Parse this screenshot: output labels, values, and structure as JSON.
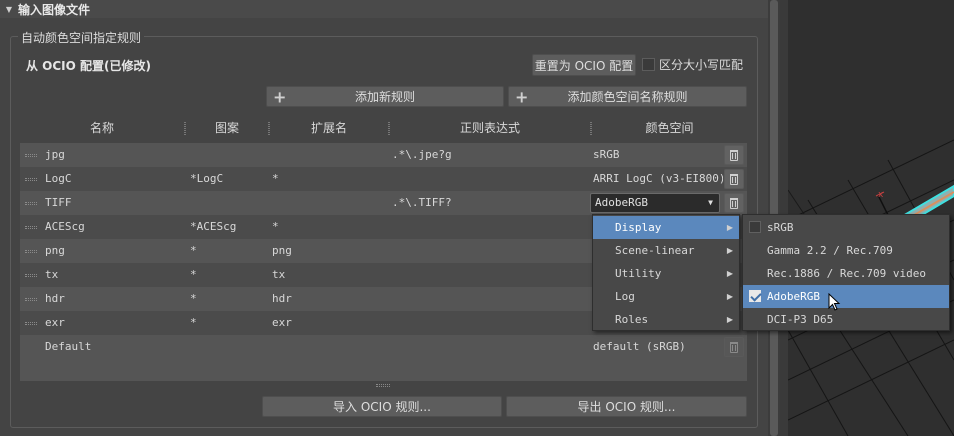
{
  "section": {
    "title": "输入图像文件"
  },
  "group": {
    "title": "自动颜色空间指定规则",
    "ocio_title": "从 OCIO 配置(已修改)",
    "reset_button": "重置为 OCIO 配置",
    "case_label": "区分大小写匹配",
    "add_rule_button": "添加新规则",
    "add_cs_rule_button": "添加颜色空间名称规则",
    "import_button": "导入 OCIO 规则...",
    "export_button": "导出 OCIO 规则..."
  },
  "table": {
    "headers": [
      "名称",
      "图案",
      "扩展名",
      "正则表达式",
      "颜色空间"
    ],
    "rows": [
      {
        "name": "jpg",
        "pattern": "",
        "ext": "",
        "regex": ".*\\.jpe?g",
        "cs": "sRGB"
      },
      {
        "name": "LogC",
        "pattern": "*LogC",
        "ext": "*",
        "regex": "",
        "cs": "ARRI LogC (v3-EI800)."
      },
      {
        "name": "TIFF",
        "pattern": "",
        "ext": "",
        "regex": ".*\\.TIFF?",
        "cs": "AdobeRGB"
      },
      {
        "name": "ACEScg",
        "pattern": "*ACEScg",
        "ext": "*",
        "regex": "",
        "cs": ""
      },
      {
        "name": "png",
        "pattern": "*",
        "ext": "png",
        "regex": "",
        "cs": ""
      },
      {
        "name": "tx",
        "pattern": "*",
        "ext": "tx",
        "regex": "",
        "cs": ""
      },
      {
        "name": "hdr",
        "pattern": "*",
        "ext": "hdr",
        "regex": "",
        "cs": ""
      },
      {
        "name": "exr",
        "pattern": "*",
        "ext": "exr",
        "regex": "",
        "cs": ""
      },
      {
        "name": "Default",
        "pattern": "",
        "ext": "",
        "regex": "",
        "cs": "default (sRGB)"
      }
    ]
  },
  "menu1": {
    "items": [
      {
        "label": "Display",
        "active": true
      },
      {
        "label": "Scene-linear",
        "active": false
      },
      {
        "label": "Utility",
        "active": false
      },
      {
        "label": "Log",
        "active": false
      },
      {
        "label": "Roles",
        "active": false
      }
    ]
  },
  "menu2": {
    "items": [
      {
        "label": "sRGB",
        "checked": false,
        "active": false
      },
      {
        "label": "Gamma 2.2 / Rec.709",
        "checked": false,
        "active": false
      },
      {
        "label": "Rec.1886 / Rec.709 video",
        "checked": false,
        "active": false
      },
      {
        "label": "AdobeRGB",
        "checked": true,
        "active": true
      },
      {
        "label": "DCI-P3 D65",
        "checked": false,
        "active": false
      }
    ]
  },
  "viewport": {
    "axis_label": "x"
  },
  "colors": {
    "accent": "#5b88bd",
    "viewport_bg": "#2f2f2f",
    "panel_bg": "#444444"
  }
}
